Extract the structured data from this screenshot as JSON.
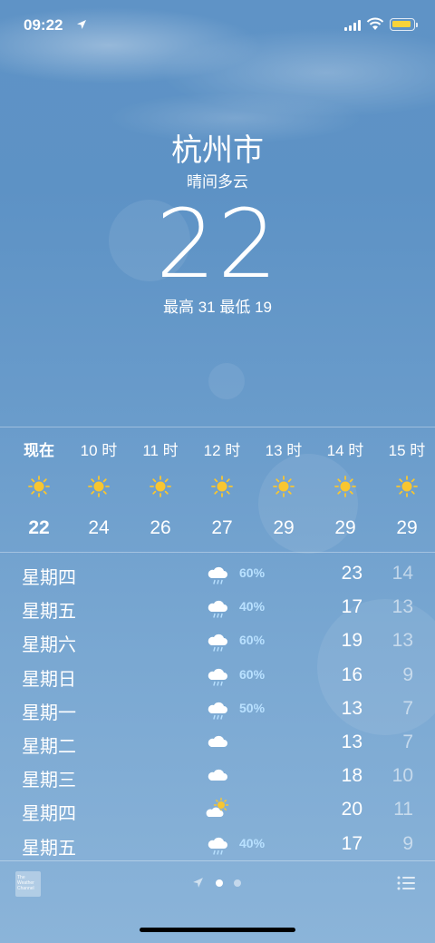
{
  "status_bar": {
    "time": "09:22",
    "icons": [
      "location-arrow-icon",
      "cellular-signal-icon",
      "wifi-icon",
      "battery-icon"
    ],
    "battery_color": "#f8d33a"
  },
  "header": {
    "city": "杭州市",
    "condition": "晴间多云",
    "temperature": "22",
    "hi_lo": "最高 31  最低 19"
  },
  "hourly": [
    {
      "label": "现在",
      "icon": "sun-icon",
      "temp": "22",
      "bold": true
    },
    {
      "label": "10 时",
      "icon": "sun-icon",
      "temp": "24",
      "bold": false
    },
    {
      "label": "11 时",
      "icon": "sun-icon",
      "temp": "26",
      "bold": false
    },
    {
      "label": "12 时",
      "icon": "sun-icon",
      "temp": "27",
      "bold": false
    },
    {
      "label": "13 时",
      "icon": "sun-icon",
      "temp": "29",
      "bold": false
    },
    {
      "label": "14 时",
      "icon": "sun-icon",
      "temp": "29",
      "bold": false
    },
    {
      "label": "15 时",
      "icon": "sun-icon",
      "temp": "29",
      "bold": false
    }
  ],
  "daily": [
    {
      "day": "星期四",
      "icon": "rain-cloud-icon",
      "precip": "60%",
      "high": "23",
      "low": "14"
    },
    {
      "day": "星期五",
      "icon": "rain-cloud-icon",
      "precip": "40%",
      "high": "17",
      "low": "13"
    },
    {
      "day": "星期六",
      "icon": "rain-cloud-icon",
      "precip": "60%",
      "high": "19",
      "low": "13"
    },
    {
      "day": "星期日",
      "icon": "rain-cloud-icon",
      "precip": "60%",
      "high": "16",
      "low": "9"
    },
    {
      "day": "星期一",
      "icon": "rain-cloud-icon",
      "precip": "50%",
      "high": "13",
      "low": "7"
    },
    {
      "day": "星期二",
      "icon": "cloud-icon",
      "precip": "",
      "high": "13",
      "low": "7"
    },
    {
      "day": "星期三",
      "icon": "cloud-icon",
      "precip": "",
      "high": "18",
      "low": "10"
    },
    {
      "day": "星期四",
      "icon": "partly-sunny-icon",
      "precip": "",
      "high": "20",
      "low": "11"
    },
    {
      "day": "星期五",
      "icon": "rain-cloud-icon",
      "precip": "40%",
      "high": "17",
      "low": "9"
    }
  ],
  "footer": {
    "logo_text": "The Weather Channel",
    "page_dots": 2,
    "active_page": 0,
    "icons": [
      "weather-channel-logo-icon",
      "location-arrow-icon",
      "list-icon"
    ]
  },
  "colors": {
    "sun": "#f8c630",
    "precip_text": "#b9e1ff",
    "sky": "#5f93c6"
  }
}
